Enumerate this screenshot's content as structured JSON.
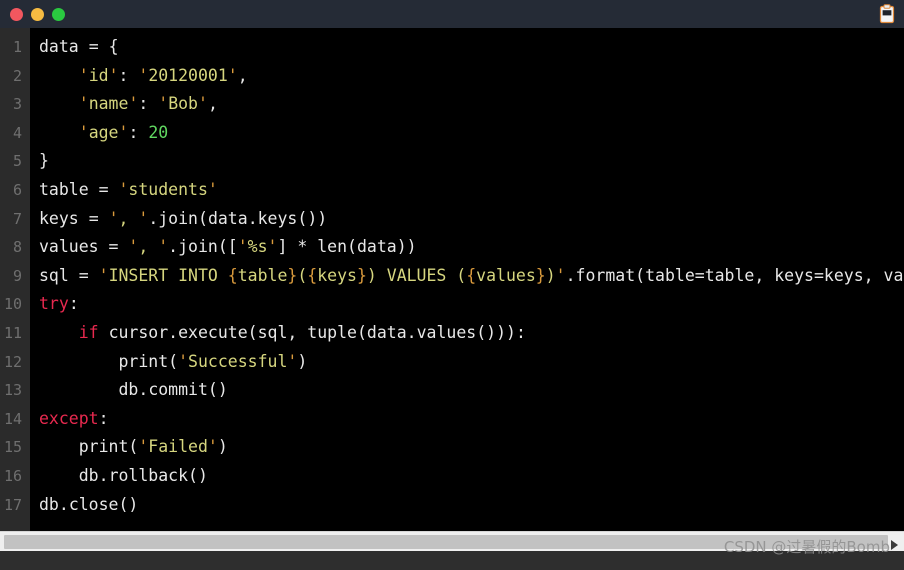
{
  "window": {
    "titlebar": {
      "buttons": [
        {
          "name": "close",
          "color": "#f2575f"
        },
        {
          "name": "minimize",
          "color": "#f6bb42"
        },
        {
          "name": "maximize",
          "color": "#2ac940"
        }
      ],
      "copy_icon": "clipboard-icon"
    }
  },
  "editor": {
    "language": "python",
    "line_numbers": [
      "1",
      "2",
      "3",
      "4",
      "5",
      "6",
      "7",
      "8",
      "9",
      "10",
      "11",
      "12",
      "13",
      "14",
      "15",
      "16",
      "17"
    ],
    "lines": [
      "data = {",
      "    'id': '20120001',",
      "    'name': 'Bob',",
      "    'age': 20",
      "}",
      "table = 'students'",
      "keys = ', '.join(data.keys())",
      "values = ', '.join(['%s'] * len(data))",
      "sql = 'INSERT INTO {table}({keys}) VALUES ({values})'.format(table=table, keys=keys, valu",
      "try:",
      "    if cursor.execute(sql, tuple(data.values())):",
      "        print('Successful')",
      "        db.commit()",
      "except:",
      "    print('Failed')",
      "    db.rollback()",
      "db.close()"
    ],
    "colors": {
      "background": "#000000",
      "gutter_background": "#2b2b2b",
      "gutter_text": "#6f6f6f",
      "default_text": "#e8e8e8",
      "keyword": "#e8294f",
      "string": "#d6d67f",
      "quote": "#d99a3c",
      "number": "#61d961",
      "brace": "#d99a3c"
    }
  },
  "scrollbar": {
    "orientation": "horizontal",
    "arrow_icon": "right-arrow-icon"
  },
  "watermark": {
    "text": "CSDN @过暑假的Bomb"
  }
}
